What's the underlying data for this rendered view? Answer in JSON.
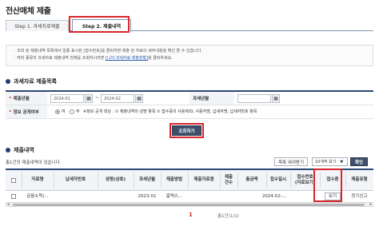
{
  "page": {
    "title": "전산매체 제출"
  },
  "tabs": [
    {
      "label": "Step 1. 과세자료제출"
    },
    {
      "label": "Step 2. 제출내역"
    }
  ],
  "notice": {
    "line1": "· 조회 된 제출내역 목록에서 일종 표시된 [접수번호]를 클릭하면 제출 된 자료의 세부내용을 확인 할 수 있습니다.",
    "line2_prefix": "· 여러 종류의 과세자료 제출내역 전체를 조회하시려면 ",
    "line2_link": "[나의 과세자료 제출현황]",
    "line2_suffix": "을 클릭하세요."
  },
  "search_section": {
    "title": "과세자료 제출목록"
  },
  "form": {
    "submit_period_label": "제출년월",
    "from": "2024-01",
    "to": "2024-02",
    "tax_year_label": "과세년월",
    "privacy_label": "정보 공개여부",
    "radio_yes": "여",
    "radio_no": "부",
    "privacy_desc": "※정보 공개 대상 : ① 제출내역의 성명 항목 ② 접수증의 사용자ID, 사용자명, 납세자명, 납세자번호 항목",
    "search_button": "조회하기"
  },
  "list_section": {
    "title": "제출내역"
  },
  "list_toolbar": {
    "total_text": "총1건의 제출내역이 있습니다.",
    "download_button": "목록 내려받기",
    "page_size": "10개씩 보기",
    "confirm_button": "확인"
  },
  "table": {
    "headers": [
      "",
      "자료명",
      "납세자번호",
      "성명(상호)",
      "과세년월",
      "제출방법",
      "제출자료용",
      "제출\n건수",
      "총금액",
      "접수일시",
      "접수번호\n(자료보기)",
      "접수증",
      "제출유형"
    ],
    "row": {
      "name": "금융소득(...",
      "taxpayer_no": "",
      "person": "",
      "tax_period": "2023-01",
      "method": "홈택스...",
      "target": "",
      "count": "",
      "amount": "",
      "received_at": "2024-02-...",
      "receipt_no": "",
      "receipt_button": "보기",
      "type": "정기신고"
    }
  },
  "pagination": {
    "current": "1",
    "count": "총1건(1/1)"
  },
  "colors": {
    "highlight": "#d9262b",
    "accent": "#2d4a78"
  }
}
